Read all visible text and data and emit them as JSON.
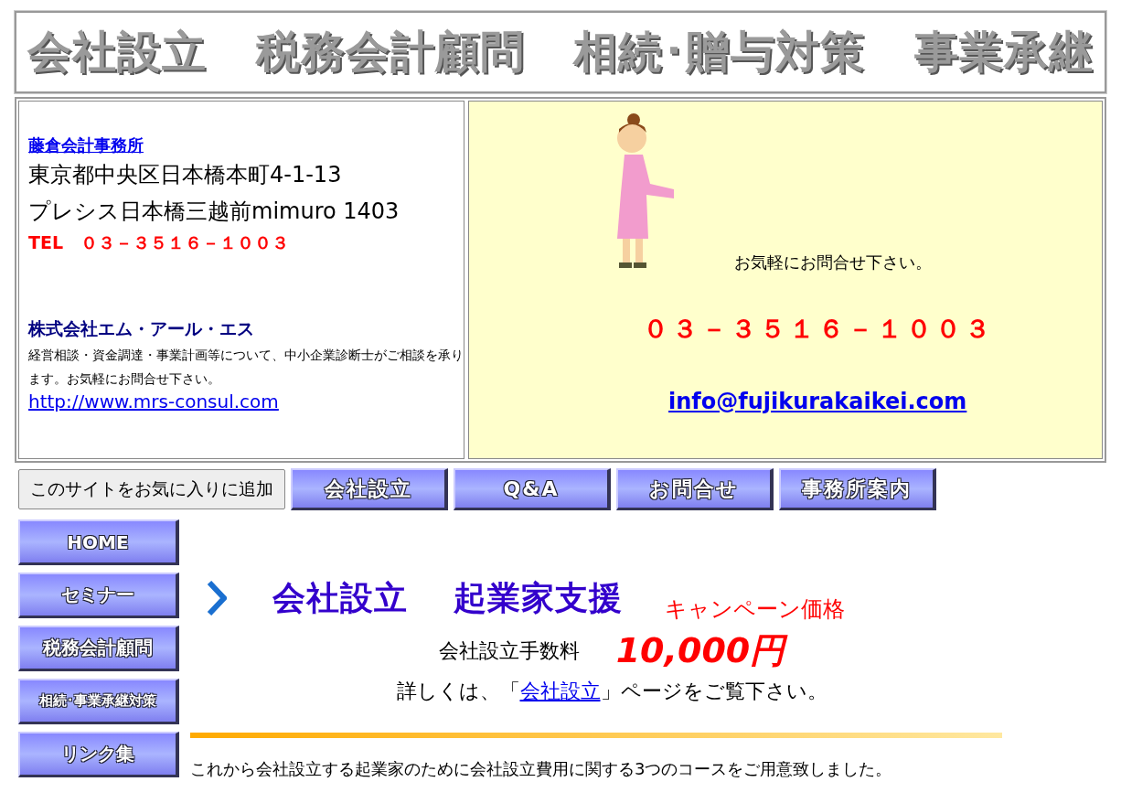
{
  "banner": {
    "items": [
      "会社設立",
      "税務会計顧問",
      "相続･贈与対策",
      "事業承継"
    ]
  },
  "contact": {
    "office_link": "藤倉会計事務所",
    "address_lines": [
      "東京都中央区日本橋本町4-1-13",
      "プレシス日本橋三越前mimuro 1403"
    ],
    "tel": "TEL　０３－３５１６－１００３",
    "company": "株式会社エム・アール・エス",
    "description": "経営相談・資金調達・事業計画等について、中小企業診断士がご相談を承ります。お気軽にお問合せ下さい。",
    "url": "http://www.mrs-consul.com"
  },
  "inquiry": {
    "message": "お気軽にお問合せ下さい。",
    "phone": "０３－３５１６－１００３",
    "email": "info@fujikurakaikei.com"
  },
  "favorite_button": "このサイトをお気に入りに追加",
  "top_nav": [
    "会社設立",
    "Q&A",
    "お問合せ",
    "事務所案内"
  ],
  "side_nav": [
    "HOME",
    "セミナー",
    "税務会計顧問",
    "相続･事業承継対策",
    "リンク集"
  ],
  "main": {
    "heading": [
      "会社設立",
      "起業家支援"
    ],
    "campaign": "キャンペーン価格",
    "fee_label": "会社設立手数料",
    "fee_price": "10,000円",
    "detail_prefix": "詳しくは、「",
    "detail_link": "会社設立",
    "detail_suffix": "」ページをご覧下さい。",
    "intro": "これから会社設立する起業家のために会社設立費用に関する3つのコースをご用意致しました。"
  }
}
